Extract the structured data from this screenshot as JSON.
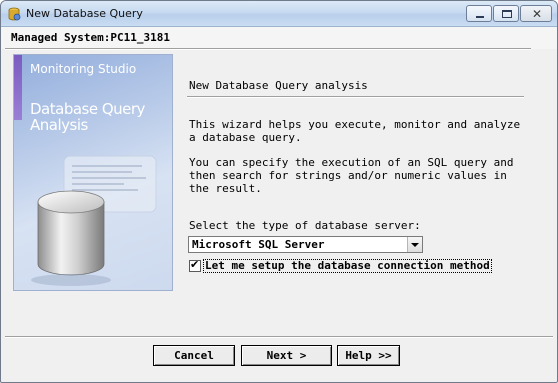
{
  "window": {
    "title": "New Database Query",
    "icons": {
      "app": "database-query-icon",
      "minimize": "minimize-icon",
      "maximize": "maximize-icon",
      "close": "close-icon"
    },
    "close_glyph": "✕"
  },
  "header": {
    "managed_system": "Managed System:PC11_3181"
  },
  "banner": {
    "studio_label": "Monitoring Studio",
    "title": "Database Query Analysis",
    "art": "database-cylinder-icon"
  },
  "content": {
    "heading": "New Database Query analysis",
    "paragraph1": "This wizard helps you execute, monitor and analyze\na database query.",
    "paragraph2": "You can specify the execution of an SQL query and\nthen search for strings and/or numeric values in\nthe result.",
    "select_label": "Select the type of database server:",
    "db_server": {
      "selected": "Microsoft SQL Server"
    },
    "setup_checkbox": {
      "checked": true,
      "check_glyph": "✔",
      "label": "Let me setup the database connection method"
    }
  },
  "footer": {
    "cancel_label": "Cancel",
    "next_label": "Next >",
    "help_label": "Help >>"
  },
  "colors": {
    "titlebar": "#c7daf0",
    "dialog_bg": "#f0f0f0",
    "banner_blue": "#b9cbe9",
    "banner_accent": "#7b5bc0"
  }
}
